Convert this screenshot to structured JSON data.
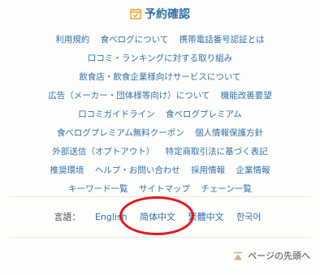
{
  "header": {
    "reserve_label": "予約確認"
  },
  "links": {
    "rows": [
      [
        "利用規約",
        "食べログについて",
        "携帯電話番号認証とは"
      ],
      [
        "口コミ・ランキングに対する取り組み"
      ],
      [
        "飲食店・飲食企業様向けサービスについて"
      ],
      [
        "広告（メーカー・団体様等向け）について",
        "機能改善要望"
      ],
      [
        "口コミガイドライン",
        "食べログプレミアム"
      ],
      [
        "食べログプレミアム無料クーポン",
        "個人情報保護方針"
      ],
      [
        "外部送信（オプトアウト）",
        "特定商取引法に基づく表記"
      ],
      [
        "推奨環境",
        "ヘルプ・お問い合わせ",
        "採用情報",
        "企業情報"
      ],
      [
        "キーワード一覧",
        "サイトマップ",
        "チェーン一覧"
      ]
    ]
  },
  "language": {
    "label": "言語：",
    "options": [
      "English",
      "简体中文",
      "繁體中文",
      "한국어"
    ],
    "highlighted": "简体中文",
    "highlight_color": "#e8151b"
  },
  "page_top": {
    "label": "ページの先頭へ"
  },
  "colors": {
    "link": "#2f6fa8",
    "icon_accent": "#e8a020",
    "background": "#fdfdfb"
  },
  "icons": {
    "reserve": "calendar-check-icon",
    "page_top": "arrow-up-to-top-icon"
  }
}
